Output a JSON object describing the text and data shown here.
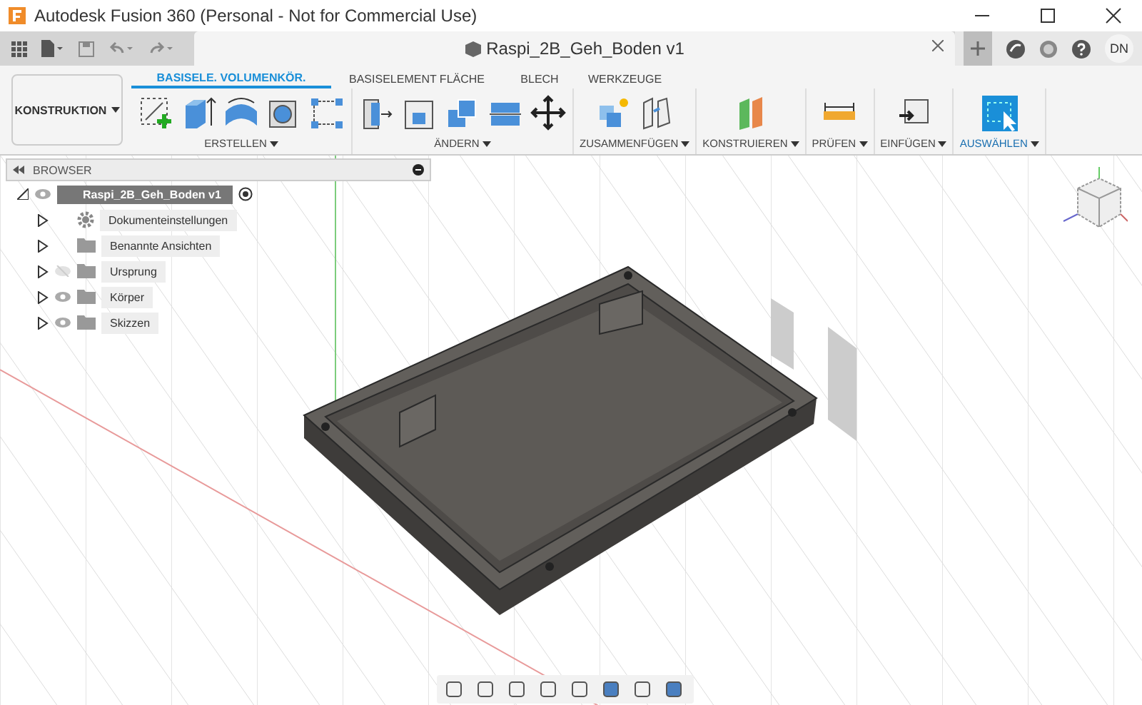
{
  "window": {
    "title": "Autodesk Fusion 360 (Personal - Not for Commercial Use)"
  },
  "document_tab": {
    "title": "Raspi_2B_Geh_Boden v1"
  },
  "user": {
    "initials": "DN"
  },
  "workspace": {
    "label": "KONSTRUKTION"
  },
  "ribbon_tabs": [
    {
      "label": "BASISELE. VOLUMENKÖR.",
      "selected": true
    },
    {
      "label": "BASISELEMENT FLÄCHE",
      "selected": false
    },
    {
      "label": "BLECH",
      "selected": false
    },
    {
      "label": "WERKZEUGE",
      "selected": false
    }
  ],
  "ribbon_groups": [
    {
      "label": "ERSTELLEN",
      "selected": false
    },
    {
      "label": "ÄNDERN",
      "selected": false
    },
    {
      "label": "ZUSAMMENFÜGEN",
      "selected": false
    },
    {
      "label": "KONSTRUIEREN",
      "selected": false
    },
    {
      "label": "PRÜFEN",
      "selected": false
    },
    {
      "label": "EINFÜGEN",
      "selected": false
    },
    {
      "label": "AUSWÄHLEN",
      "selected": true
    }
  ],
  "browser": {
    "title": "BROWSER",
    "root": {
      "label": "Raspi_2B_Geh_Boden v1",
      "expanded": true,
      "children": [
        {
          "label": "Dokumenteinstellungen",
          "kind": "settings"
        },
        {
          "label": "Benannte Ansichten",
          "kind": "folder"
        },
        {
          "label": "Ursprung",
          "kind": "folder",
          "visible": false
        },
        {
          "label": "Körper",
          "kind": "folder",
          "visible": true
        },
        {
          "label": "Skizzen",
          "kind": "folder",
          "visible": true
        }
      ]
    }
  }
}
